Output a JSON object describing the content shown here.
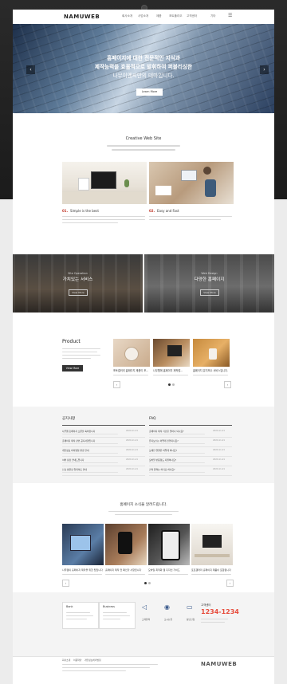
{
  "header": {
    "logo": "NAMUWEB",
    "nav": [
      "회사소개",
      "사업소개",
      "제품",
      "포트폴리오",
      "고객센터",
      "기타"
    ]
  },
  "hero": {
    "line1": "홈페이지에 대한 전문적인 지식과",
    "line2": "제작능력을 효율적으로 발휘하여 퍼블리싱한",
    "line3": "나무이엔씨만의 테마입니다.",
    "button": "Learn More",
    "prev": "‹",
    "next": "›"
  },
  "creative": {
    "title": "Creative Web Site",
    "items": [
      {
        "num": "01.",
        "title": "Simple is the best"
      },
      {
        "num": "02.",
        "title": "Easy and Fast"
      }
    ]
  },
  "banners": [
    {
      "small": "Site Operation",
      "title": "가치있는 서비스",
      "button": "View More"
    },
    {
      "small": "Web Design",
      "title": "다양한 홈페이지",
      "button": "View More"
    }
  ],
  "product": {
    "title": "Product",
    "button": "View More",
    "cards": [
      {
        "caption": "포토갤러리 홈페이지 제품이 포..."
      },
      {
        "caption": "나무웹에 홈페이지 제작할..."
      },
      {
        "caption": "홈페이지 유지보수 서비스입니다."
      }
    ],
    "prev": "‹",
    "next": "›"
  },
  "notice": {
    "title": "공지사항",
    "rows": [
      "나무웹 홈페이지 오픈을 축하합니다",
      "홈페이지 제작 관련 공지사항입니다",
      "개인정보 처리방침 변경 안내",
      "서버 점검 안내드립니다",
      "신규 템플릿 업데이트 안내"
    ],
    "dates": [
      "2020-11-21",
      "2020-11-21",
      "2020-11-21",
      "2020-11-21",
      "2020-11-21"
    ]
  },
  "faq": {
    "title": "FAQ",
    "rows": [
      "홈페이지 제작 기간은 얼마나 되나요?",
      "유지보수는 어떻게 진행되나요?",
      "도메인 연결은 어떻게 하나요?",
      "모바일 반응형도 지원하나요?",
      "견적 문의는 어디로 하나요?"
    ],
    "dates": [
      "2020-11-21",
      "2020-11-21",
      "2020-11-21",
      "2020-11-21",
      "2020-11-21"
    ]
  },
  "news": {
    "title": "홈페이지 소식을 알려드립니다.",
    "cards": [
      {
        "caption": "나무웹의 홈페이지 제작을 위한 팁입니다"
      },
      {
        "caption": "홈페이지 제작 전 확인할 사항입니다"
      },
      {
        "caption": "모바일 최적화 웹 디자인 가이드"
      },
      {
        "caption": "포토갤러리 홈페이지 제품이 포함됩니다"
      }
    ]
  },
  "contact": {
    "box1": "Bank",
    "box2": "Business",
    "icons": [
      "고객문의",
      "오시는길",
      "상담신청"
    ],
    "phone_label": "고객센터",
    "phone": "1234-1234"
  },
  "footer": {
    "links": [
      "회사소개",
      "이용약관",
      "개인정보처리방침"
    ],
    "logo": "NAMUWEB"
  },
  "colors": {
    "accent": "#c0392b",
    "dark": "#2b2b2b",
    "phone": "#e74c3c"
  }
}
